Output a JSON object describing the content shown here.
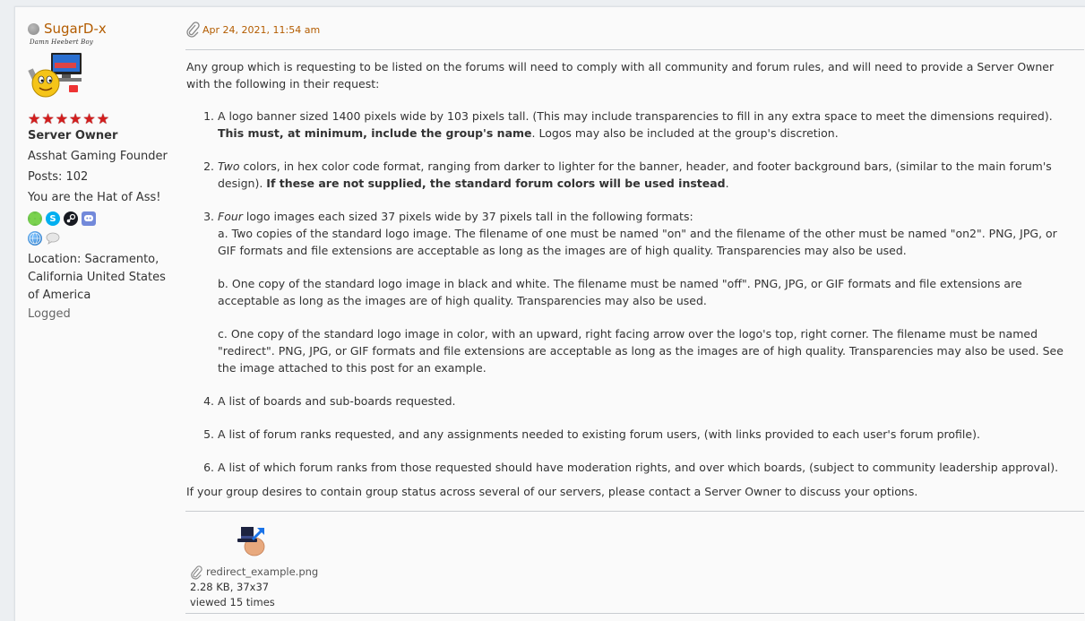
{
  "poster": {
    "name": "SugarD-x",
    "custom_title": "Damn Heebert Boy",
    "stars": 6,
    "membergroup": "Server Owner",
    "title": "Asshat Gaming Founder",
    "posts": "Posts: 102",
    "blurb": "You are the Hat of Ass!",
    "icons": [
      "clover-icon",
      "skype-icon",
      "steam-icon",
      "discord-icon",
      "website-icon",
      "chat-bubble-icon"
    ],
    "location": "Location: Sacramento, California United States of America",
    "logged": "Logged",
    "colors": {
      "name": "#b35c00",
      "stars": "#d21d1d"
    }
  },
  "post": {
    "date": "Apr 24, 2021, 11:54 am",
    "intro": "Any group which is requesting to be listed on the forums will need to comply with all community and forum rules, and will need to provide a Server Owner with the following in their request:",
    "items": [
      {
        "a": "A logo banner sized 1400 pixels wide by 103 pixels tall. (This may include transparencies to fill in any extra space to meet the dimensions required). ",
        "b": "This must, at minimum, include the group's name",
        "c": ". Logos may also be included at the group's discretion."
      },
      {
        "em": "Two",
        "a": " colors, in hex color code format, ranging from darker to lighter for the banner, header, and footer background bars, (similar to the main forum's design). ",
        "b": "If these are not supplied, the standard forum colors will be used instead",
        "c": "."
      },
      {
        "em": "Four",
        "a": " logo images each sized 37 pixels wide by 37 pixels tall in the following formats:",
        "sub_a": "a. Two copies of the standard logo image. The filename of one must be named \"on\" and the filename of the other must be named \"on2\". PNG, JPG, or GIF formats and file extensions are acceptable as long as the images are of high quality. Transparencies may also be used.",
        "sub_b": "b. One copy of the standard logo image in black and white. The filename must be named \"off\". PNG, JPG, or GIF formats and file extensions are acceptable as long as the images are of high quality. Transparencies may also be used.",
        "sub_c": "c. One copy of the standard logo image in color, with an upward, right facing arrow over the logo's top, right corner. The filename must be named \"redirect\". PNG, JPG, or GIF formats and file extensions are acceptable as long as the images are of high quality. Transparencies may also be used. See the image attached to this post for an example."
      },
      {
        "a": "A list of boards and sub-boards requested."
      },
      {
        "a": "A list of forum ranks requested, and any assignments needed to existing forum users, (with links provided to each user's forum profile)."
      },
      {
        "a": "A list of which forum ranks from those requested should have moderation rights, and over which boards, (subject to community leadership approval)."
      }
    ],
    "outro": "If your group desires to contain group status across several of our servers, please contact a Server Owner to discuss your options."
  },
  "attachment": {
    "filename": "redirect_example.png",
    "size": "2.28 KB, 37x37",
    "views": "viewed 15 times"
  }
}
